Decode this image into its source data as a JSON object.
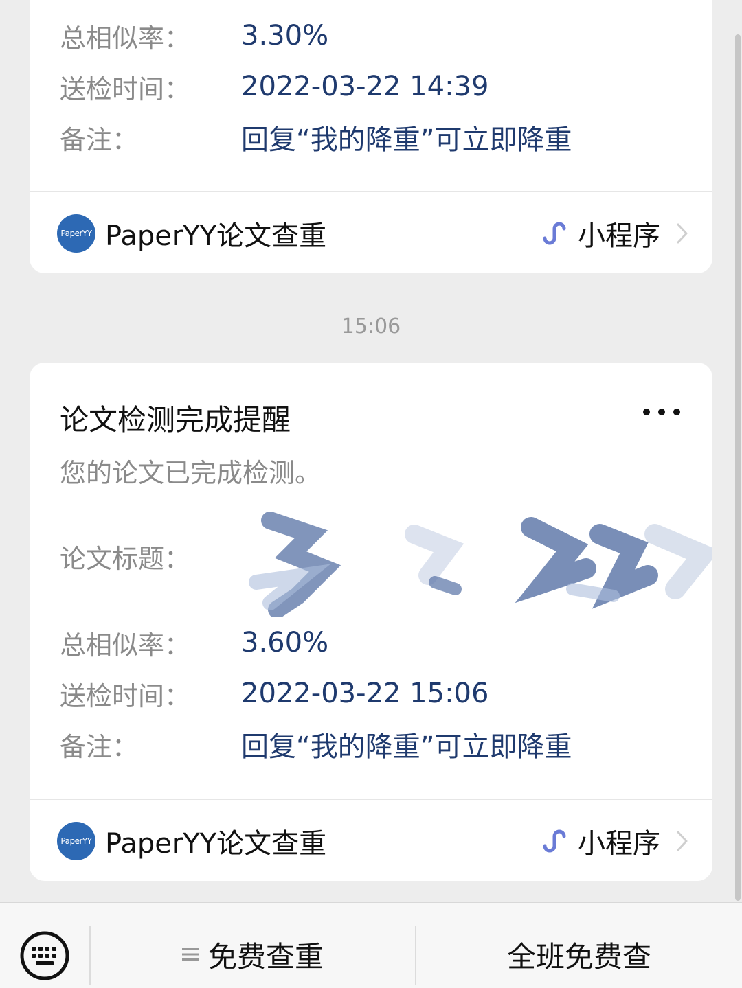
{
  "card1": {
    "rows": [
      {
        "label": "总相似率：",
        "value": "3.30%"
      },
      {
        "label": "送检时间：",
        "value": "2022-03-22 14:39"
      },
      {
        "label": "备注：",
        "value": "回复“我的降重”可立即降重"
      }
    ],
    "footer": {
      "logo_text": "PaperYY",
      "brand": "PaperYY论文查重",
      "mini_program": "小程序"
    }
  },
  "timestamp": "15:06",
  "card2": {
    "title": "论文检测完成提醒",
    "description": "您的论文已完成检测。",
    "title_label": "论文标题：",
    "rows": [
      {
        "label": "总相似率：",
        "value": "3.60%"
      },
      {
        "label": "送检时间：",
        "value": "2022-03-22 15:06"
      },
      {
        "label": "备注：",
        "value": "回复“我的降重”可立即降重"
      }
    ],
    "footer": {
      "logo_text": "PaperYY",
      "brand": "PaperYY论文查重",
      "mini_program": "小程序"
    }
  },
  "bottom_bar": {
    "tabs": [
      "免费查重",
      "全班免费查"
    ]
  },
  "colors": {
    "background": "#ededed",
    "value_text": "#1f3a6e",
    "label_text": "#8a8a8a",
    "logo_blue": "#2d69b4",
    "mini_program_icon": "#6a7bd6"
  }
}
